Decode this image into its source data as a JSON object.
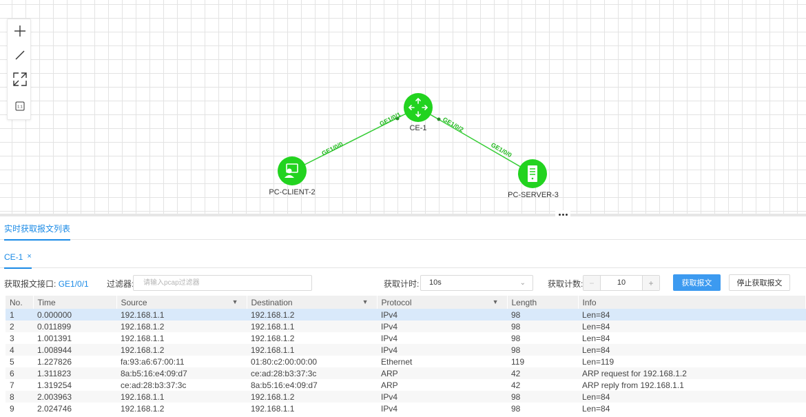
{
  "topology": {
    "tools": [
      {
        "icon": "add-icon"
      },
      {
        "icon": "line-icon"
      },
      {
        "icon": "fit-screen-icon"
      },
      {
        "icon": "ratio-icon",
        "text": "1:1"
      }
    ],
    "devices": [
      {
        "id": "ce1",
        "label": "CE-1",
        "type": "router",
        "icon": "router-icon"
      },
      {
        "id": "client",
        "label": "PC-CLIENT-2",
        "type": "pc",
        "icon": "client-pc-icon"
      },
      {
        "id": "server",
        "label": "PC-SERVER-3",
        "type": "server",
        "icon": "server-icon"
      }
    ],
    "links": [
      {
        "from": "client",
        "to": "ce1",
        "from_port": "GE1/0/0",
        "to_port": "GE1/0/1"
      },
      {
        "from": "ce1",
        "to": "server",
        "from_port": "GE1/0/2",
        "to_port": "GE1/0/0"
      }
    ],
    "colors": {
      "device": "#22d31f",
      "link": "#33cc33"
    }
  },
  "panel": {
    "tab_label": "实时获取报文列表",
    "device_tab": {
      "label": "CE-1",
      "close": "×"
    },
    "interface_label": "获取报文接口:",
    "interface_value": "GE1/0/1",
    "filter_label": "过滤器:",
    "filter_placeholder": "请输入pcap过滤器",
    "timer_label": "获取计时:",
    "timer_value": "10s",
    "count_label": "获取计数:",
    "count_value": "10",
    "minus": "−",
    "plus": "+",
    "capture_button": "获取报文",
    "stop_button": "停止获取报文"
  },
  "table": {
    "columns": [
      "No.",
      "Time",
      "Source",
      "Destination",
      "Protocol",
      "Length",
      "Info"
    ],
    "selected_row": 0,
    "rows": [
      [
        "1",
        "0.000000",
        "192.168.1.1",
        "192.168.1.2",
        "IPv4",
        "98",
        "Len=84"
      ],
      [
        "2",
        "0.011899",
        "192.168.1.2",
        "192.168.1.1",
        "IPv4",
        "98",
        "Len=84"
      ],
      [
        "3",
        "1.001391",
        "192.168.1.1",
        "192.168.1.2",
        "IPv4",
        "98",
        "Len=84"
      ],
      [
        "4",
        "1.008944",
        "192.168.1.2",
        "192.168.1.1",
        "IPv4",
        "98",
        "Len=84"
      ],
      [
        "5",
        "1.227826",
        "fa:93:a6:67:00:11",
        "01:80:c2:00:00:00",
        "Ethernet",
        "119",
        "Len=119"
      ],
      [
        "6",
        "1.311823",
        "8a:b5:16:e4:09:d7",
        "ce:ad:28:b3:37:3c",
        "ARP",
        "42",
        "ARP request for 192.168.1.2"
      ],
      [
        "7",
        "1.319254",
        "ce:ad:28:b3:37:3c",
        "8a:b5:16:e4:09:d7",
        "ARP",
        "42",
        "ARP reply from 192.168.1.1"
      ],
      [
        "8",
        "2.003963",
        "192.168.1.1",
        "192.168.1.2",
        "IPv4",
        "98",
        "Len=84"
      ],
      [
        "9",
        "2.024746",
        "192.168.1.2",
        "192.168.1.1",
        "IPv4",
        "98",
        "Len=84"
      ]
    ]
  }
}
